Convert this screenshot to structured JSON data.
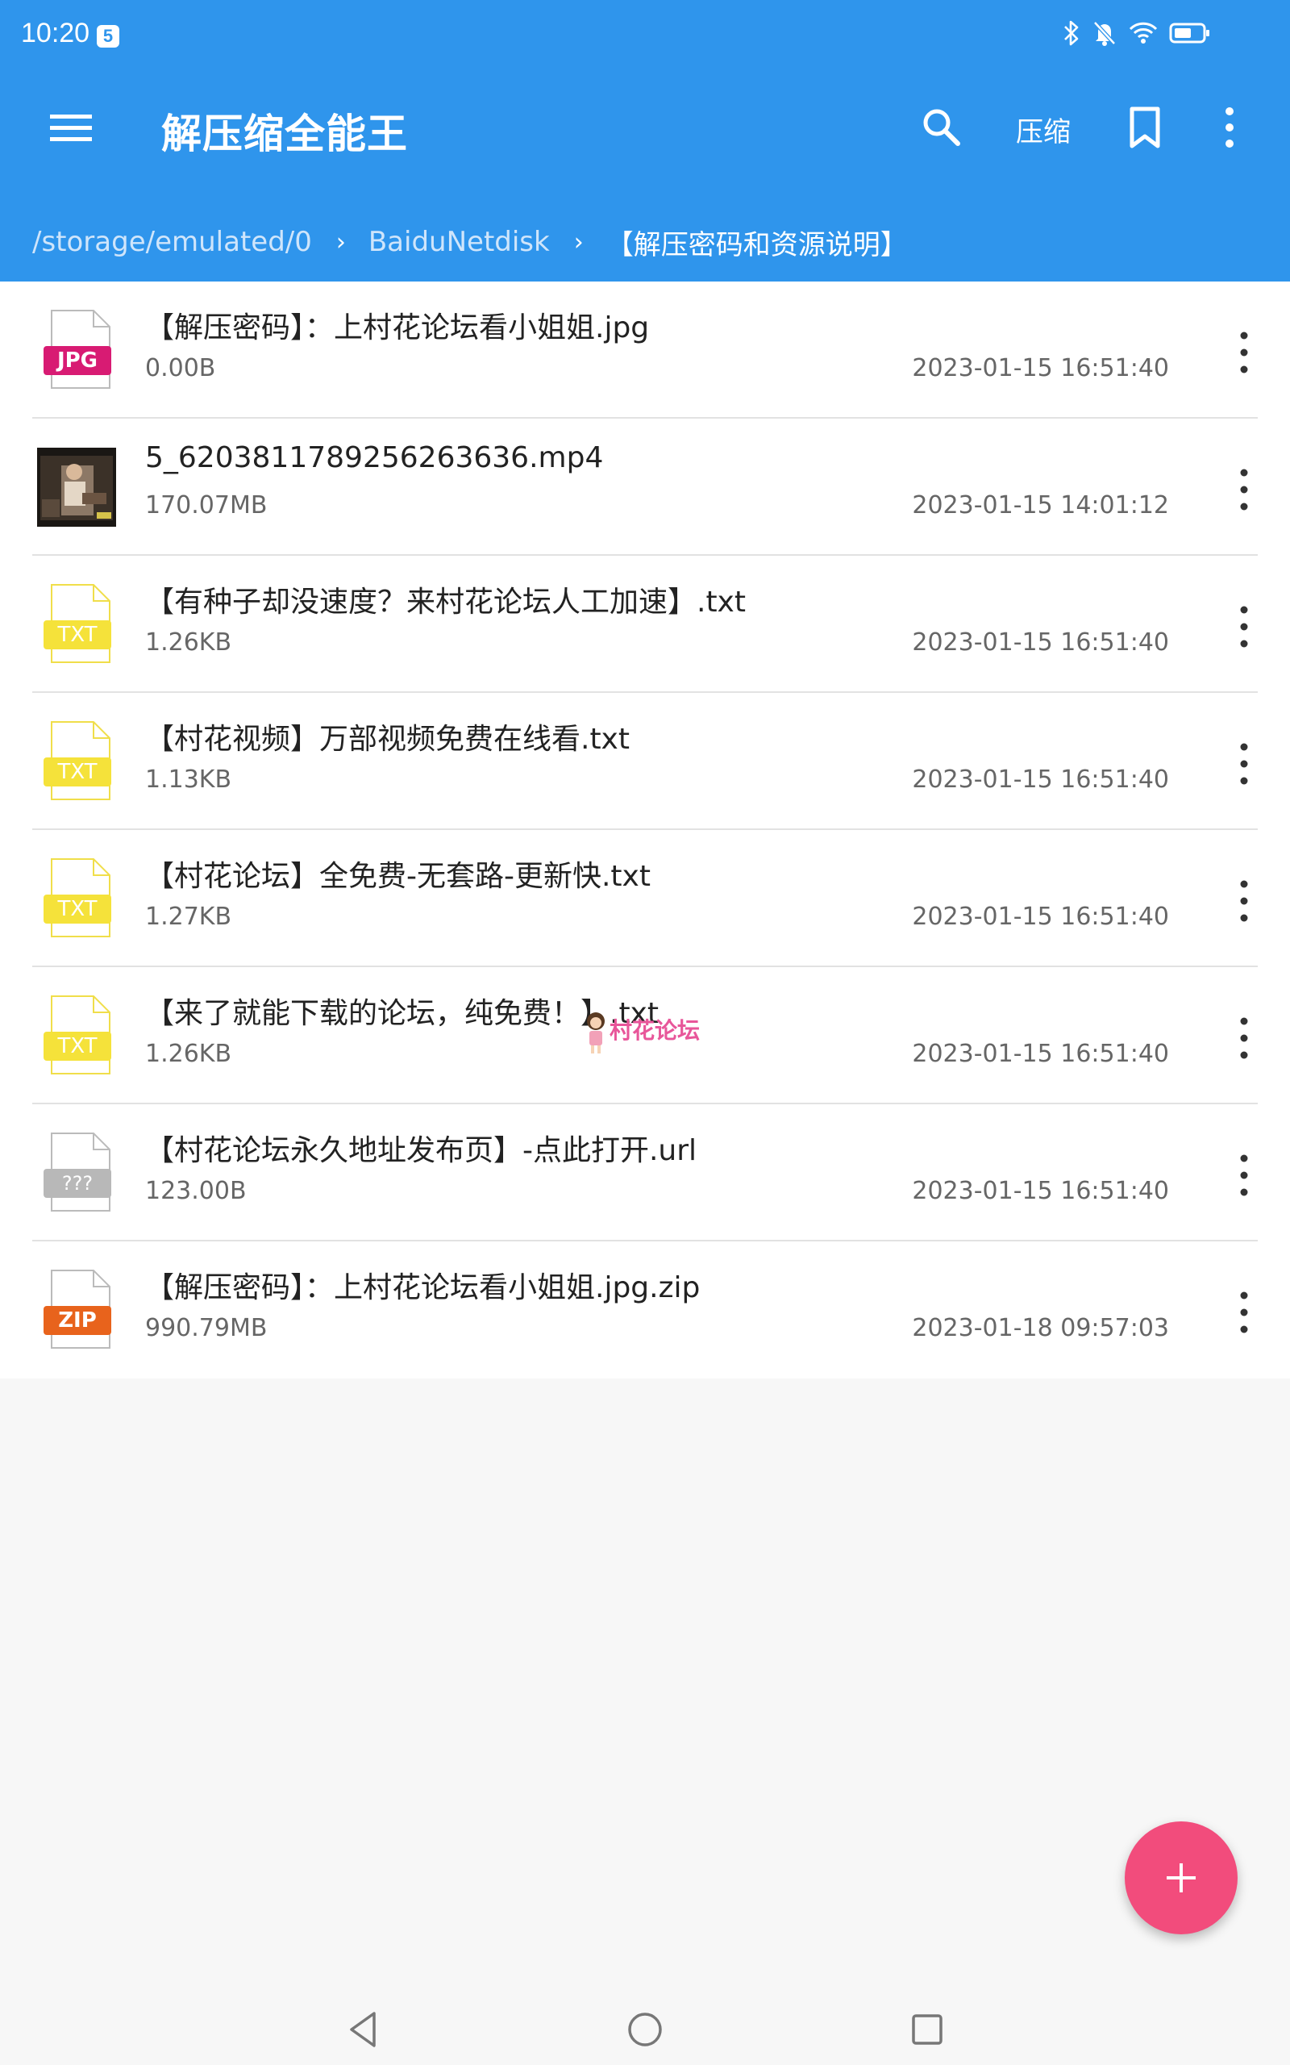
{
  "status_bar": {
    "time": "10:20",
    "badge": "5",
    "icons": [
      "bluetooth-icon",
      "mute-bell-icon",
      "wifi-icon",
      "battery-icon"
    ]
  },
  "app_bar": {
    "title": "解压缩全能王",
    "compress_label": "压缩",
    "accent_color": "#2f95ec"
  },
  "breadcrumb": [
    {
      "label": "/storage/emulated/0"
    },
    {
      "label": "BaiduNetdisk"
    },
    {
      "label": "【解压密码和资源说明】"
    }
  ],
  "files": [
    {
      "name": "【解压密码】：上村花论坛看小姐姐.jpg",
      "size": "0.00B",
      "date": "2023-01-15 16:51:40",
      "type": "JPG",
      "icon": "jpg-file-icon",
      "color": "#d81b73"
    },
    {
      "name": "5_6203811789256263636.mp4",
      "size": "170.07MB",
      "date": "2023-01-15 14:01:12",
      "type": "video",
      "icon": "video-thumbnail",
      "color": "#333333"
    },
    {
      "name": "【有种子却没速度？来村花论坛人工加速】.txt",
      "size": "1.26KB",
      "date": "2023-01-15 16:51:40",
      "type": "TXT",
      "icon": "txt-file-icon",
      "color": "#f5e23a"
    },
    {
      "name": "【村花视频】万部视频免费在线看.txt",
      "size": "1.13KB",
      "date": "2023-01-15 16:51:40",
      "type": "TXT",
      "icon": "txt-file-icon",
      "color": "#f5e23a"
    },
    {
      "name": "【村花论坛】全免费-无套路-更新快.txt",
      "size": "1.27KB",
      "date": "2023-01-15 16:51:40",
      "type": "TXT",
      "icon": "txt-file-icon",
      "color": "#f5e23a"
    },
    {
      "name": "【来了就能下载的论坛，纯免费！】.txt",
      "size": "1.26KB",
      "date": "2023-01-15 16:51:40",
      "type": "TXT",
      "icon": "txt-file-icon",
      "color": "#f5e23a"
    },
    {
      "name": "【村花论坛永久地址发布页】-点此打开.url",
      "size": "123.00B",
      "date": "2023-01-15 16:51:40",
      "type": "???",
      "icon": "unknown-file-icon",
      "color": "#b8b8b8"
    },
    {
      "name": "【解压密码】：上村花论坛看小姐姐.jpg.zip",
      "size": "990.79MB",
      "date": "2023-01-18 09:57:03",
      "type": "ZIP",
      "icon": "zip-file-icon",
      "color": "#e8631c"
    }
  ],
  "watermark": {
    "text": "村花论坛"
  },
  "fab": {
    "icon": "plus-icon",
    "color": "#f24c7c"
  },
  "nav_bar": {
    "icons": [
      "back-icon",
      "home-icon",
      "recents-icon"
    ]
  }
}
